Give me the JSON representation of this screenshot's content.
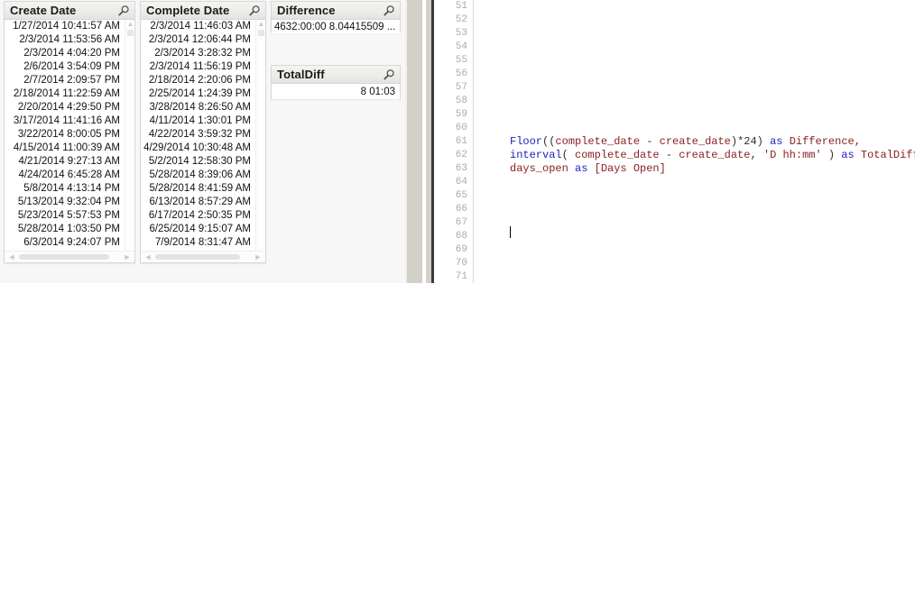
{
  "listboxes": [
    {
      "id": "create-date",
      "title": "Create Date",
      "search_icon": "search-icon",
      "values": [
        "1/27/2014 10:41:57 AM",
        "2/3/2014 11:53:56 AM",
        "2/3/2014 4:04:20 PM",
        "2/6/2014 3:54:09 PM",
        "2/7/2014 2:09:57 PM",
        "2/18/2014 11:22:59 AM",
        "2/20/2014 4:29:50 PM",
        "3/17/2014 11:41:16 AM",
        "3/22/2014 8:00:05 PM",
        "4/15/2014 11:00:39 AM",
        "4/21/2014 9:27:13 AM",
        "4/24/2014 6:45:28 AM",
        "5/8/2014 4:13:14 PM",
        "5/13/2014 9:32:04 PM",
        "5/23/2014 5:57:53 PM",
        "5/28/2014 1:03:50 PM",
        "6/3/2014 9:24:07 PM"
      ]
    },
    {
      "id": "complete-date",
      "title": "Complete Date",
      "search_icon": "search-icon",
      "values": [
        "2/3/2014 11:46:03 AM",
        "2/3/2014 12:06:44 PM",
        "2/3/2014 3:28:32 PM",
        "2/3/2014 11:56:19 PM",
        "2/18/2014 2:20:06 PM",
        "2/25/2014 1:24:39 PM",
        "3/28/2014 8:26:50 AM",
        "4/11/2014 1:30:01 PM",
        "4/22/2014 3:59:32 PM",
        "4/29/2014 10:30:48 AM",
        "5/2/2014 12:58:30 PM",
        "5/28/2014 8:39:06 AM",
        "5/28/2014 8:41:59 AM",
        "6/13/2014 8:57:29 AM",
        "6/17/2014 2:50:35 PM",
        "6/25/2014 9:15:07 AM",
        "7/9/2014 8:31:47 AM"
      ]
    }
  ],
  "difference_box": {
    "id": "difference",
    "title": "Difference",
    "search_icon": "search-icon",
    "value": "4632:00:00 8.04415509 ..."
  },
  "totaldiff_box": {
    "id": "totaldiff",
    "title": "TotalDiff",
    "search_icon": "search-icon",
    "value": "8 01:03"
  },
  "scrollbar": {
    "up_arrow": "▲",
    "down_arrow": "▼",
    "left_arrow": "◄",
    "right_arrow": "►"
  },
  "editor": {
    "line_numbers": [
      51,
      52,
      53,
      54,
      55,
      56,
      57,
      58,
      59,
      60,
      61,
      62,
      63,
      64,
      65,
      66,
      67,
      68,
      69,
      70,
      71
    ],
    "caret_line": 68,
    "lines": [
      {
        "n": 51,
        "tokens": []
      },
      {
        "n": 52,
        "tokens": []
      },
      {
        "n": 53,
        "tokens": []
      },
      {
        "n": 54,
        "tokens": []
      },
      {
        "n": 55,
        "tokens": []
      },
      {
        "n": 56,
        "tokens": []
      },
      {
        "n": 57,
        "tokens": []
      },
      {
        "n": 58,
        "tokens": []
      },
      {
        "n": 59,
        "tokens": []
      },
      {
        "n": 60,
        "tokens": []
      },
      {
        "n": 61,
        "tokens": [
          {
            "t": "Floor",
            "c": "kw"
          },
          {
            "t": "((",
            "c": "pun"
          },
          {
            "t": "complete_date",
            "c": "id"
          },
          {
            "t": " - ",
            "c": "pun"
          },
          {
            "t": "create_date",
            "c": "id"
          },
          {
            "t": ")*24) ",
            "c": "pun"
          },
          {
            "t": "as",
            "c": "kw"
          },
          {
            "t": " ",
            "c": "pun"
          },
          {
            "t": "Difference,",
            "c": "id"
          }
        ]
      },
      {
        "n": 62,
        "tokens": [
          {
            "t": "interval",
            "c": "kw"
          },
          {
            "t": "( ",
            "c": "pun"
          },
          {
            "t": "complete_date",
            "c": "id"
          },
          {
            "t": " - ",
            "c": "pun"
          },
          {
            "t": "create_date",
            "c": "id"
          },
          {
            "t": ", ",
            "c": "pun"
          },
          {
            "t": "'D hh:mm'",
            "c": "str"
          },
          {
            "t": " ) ",
            "c": "pun"
          },
          {
            "t": "as",
            "c": "kw"
          },
          {
            "t": " ",
            "c": "pun"
          },
          {
            "t": "TotalDiff,",
            "c": "id"
          }
        ]
      },
      {
        "n": 63,
        "tokens": [
          {
            "t": "days_open",
            "c": "id"
          },
          {
            "t": " ",
            "c": "pun"
          },
          {
            "t": "as",
            "c": "kw"
          },
          {
            "t": " ",
            "c": "pun"
          },
          {
            "t": "[Days Open]",
            "c": "id"
          }
        ]
      },
      {
        "n": 64,
        "tokens": []
      },
      {
        "n": 65,
        "tokens": []
      },
      {
        "n": 66,
        "tokens": []
      },
      {
        "n": 67,
        "tokens": []
      },
      {
        "n": 68,
        "tokens": []
      },
      {
        "n": 69,
        "tokens": []
      },
      {
        "n": 70,
        "tokens": []
      },
      {
        "n": 71,
        "tokens": []
      }
    ]
  },
  "colors": {
    "keyword": "#2020c0",
    "identifier": "#8a2020",
    "gutter_text": "#a9a9b4",
    "caption_bg": "#ececea",
    "panel_bg": "#f7f7f7",
    "divider_gray": "#d3d0c8",
    "divider_dark": "#3a3a3a"
  }
}
